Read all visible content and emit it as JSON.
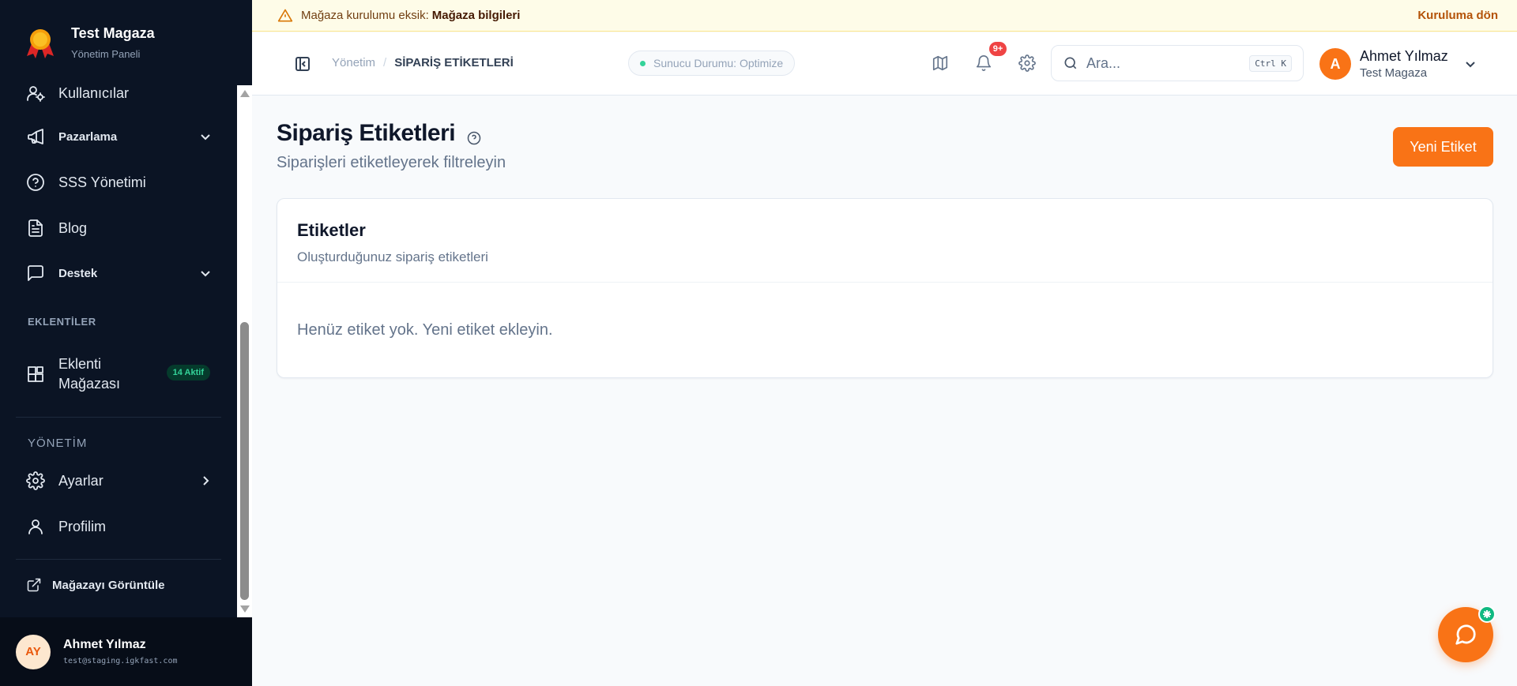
{
  "brand": {
    "title": "Test Magaza",
    "subtitle": "Yönetim Paneli"
  },
  "sidebar": {
    "items": [
      {
        "label": "Kullanıcılar",
        "icon": "users-icon"
      },
      {
        "label": "Pazarlama",
        "icon": "megaphone-icon",
        "expandable": true
      },
      {
        "label": "SSS Yönetimi",
        "icon": "help-circle-icon"
      },
      {
        "label": "Blog",
        "icon": "document-icon"
      },
      {
        "label": "Destek",
        "icon": "message-square-icon",
        "expandable": true
      }
    ],
    "section_plugins": "EKLENTİLER",
    "plugin_store": {
      "label": "Eklenti Mağazası",
      "line1": "Eklenti",
      "line2": "Mağazası",
      "badge": "14 Aktif"
    },
    "section_admin": "YÖNETİM",
    "admin_items": [
      {
        "label": "Ayarlar",
        "icon": "gear-icon"
      },
      {
        "label": "Profilim",
        "icon": "user-icon"
      }
    ],
    "view_store": "Mağazayı Görüntüle",
    "footer": {
      "initials": "AY",
      "name": "Ahmet Yılmaz",
      "email": "test@staging.igkfast.com"
    }
  },
  "banner": {
    "text": "Mağaza kurulumu eksik:",
    "highlight": "Mağaza bilgileri",
    "action": "Kuruluma dön"
  },
  "header": {
    "breadcrumb": {
      "root": "Yönetim",
      "separator": "/",
      "current": "SİPARİŞ ETİKETLERİ"
    },
    "server_status": "Sunucu Durumu: Optimize",
    "notifications_badge": "9+",
    "search": {
      "placeholder": "Ara...",
      "shortcut": "Ctrl K"
    },
    "user": {
      "initial": "A",
      "name": "Ahmet Yılmaz",
      "store": "Test Magaza"
    }
  },
  "main": {
    "title": "Sipariş Etiketleri",
    "subtitle": "Siparişleri etiketleyerek filtreleyin",
    "new_button": "Yeni Etiket",
    "card": {
      "title": "Etiketler",
      "subtitle": "Oluşturduğunuz sipariş etiketleri",
      "empty": "Henüz etiket yok. Yeni etiket ekleyin."
    }
  },
  "colors": {
    "accent": "#f97316",
    "sidebar_bg": "#0b1424",
    "success": "#10b981",
    "danger": "#ef4444"
  }
}
